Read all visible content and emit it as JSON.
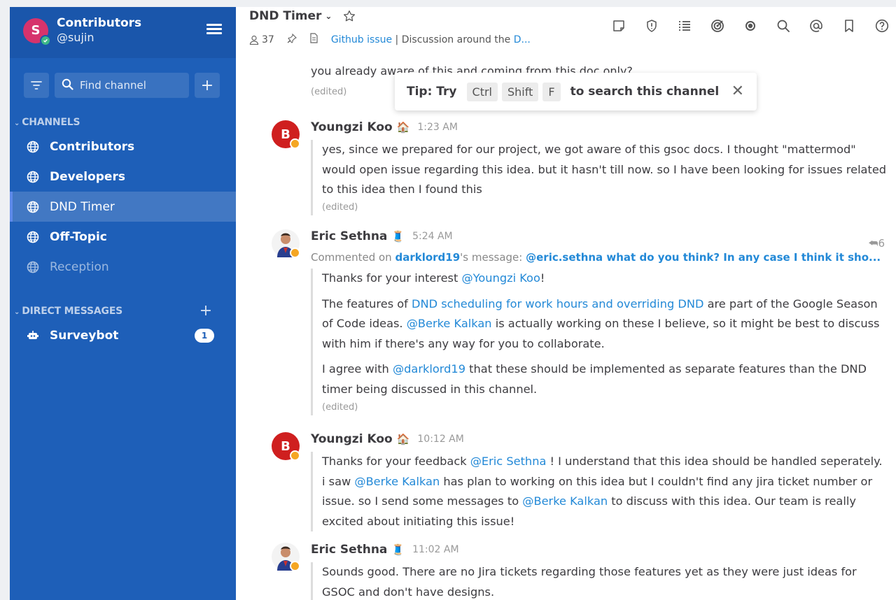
{
  "team": {
    "initial": "S",
    "name": "Contributors",
    "user": "@sujin"
  },
  "sidebar": {
    "find_placeholder": "Find channel",
    "channels_title": "CHANNELS",
    "channels": [
      {
        "label": "Contributors"
      },
      {
        "label": "Developers"
      },
      {
        "label": "DND Timer"
      },
      {
        "label": "Off-Topic"
      },
      {
        "label": "Reception"
      }
    ],
    "dm_title": "DIRECT MESSAGES",
    "dms": [
      {
        "label": "Surveybot",
        "badge": "1"
      }
    ]
  },
  "channel": {
    "title": "DND Timer",
    "members": "37",
    "link": "Github issue",
    "separator": " | ",
    "purpose": "Discussion around the ",
    "purpose_link": "D..."
  },
  "tip": {
    "prefix": "Tip: Try",
    "keys": [
      "Ctrl",
      "Shift",
      "F"
    ],
    "suffix": "to search this channel"
  },
  "top_fragment": "you already aware of this and coming from this doc only?",
  "top_edited": "(edited)",
  "posts": [
    {
      "initial": "B",
      "name": "Youngzi Koo",
      "emoji": "🏠",
      "time": "1:23 AM",
      "body": "yes, since we prepared for our project, we got aware of this gsoc docs. I thought \"mattermod\" would open issue regarding this idea. but it hasn't till now. so I have been looking for issues related to this idea then I found this",
      "edited": "(edited)"
    },
    {
      "name": "Eric Sethna",
      "emoji": "🧵",
      "time": "5:24 AM",
      "reply_count": "6",
      "commented_prefix": "Commented on ",
      "commented_user": "darklord19",
      "commented_mid": "'s message: ",
      "commented_text": "@eric.sethna what do you think? In any case I think it sho...",
      "p1_a": "Thanks for your interest ",
      "p1_m": "@Youngzi Koo",
      "p1_b": "!",
      "p2_a": "The features of ",
      "p2_l": "DND scheduling for work hours and overriding DND",
      "p2_b": " are part of the Google Season of Code ideas. ",
      "p2_m": "@Berke Kalkan",
      "p2_c": " is actually working on these I believe, so it might be best to discuss with him if there's any way for you to collaborate.",
      "p3_a": "I agree with ",
      "p3_m": "@darklord19",
      "p3_b": " that these should be implemented as separate features than the DND timer being discussed in this channel.",
      "edited": "(edited)"
    },
    {
      "initial": "B",
      "name": "Youngzi Koo",
      "emoji": "🏠",
      "time": "10:12 AM",
      "a": "Thanks for your feedback ",
      "m1": "@Eric Sethna",
      "b": " ! I understand that this idea should be handled seperately. i saw ",
      "m2": "@Berke Kalkan",
      "c": " has plan to working on this idea but I couldn't find any jira ticket number or issue. so I send some messages to ",
      "m3": "@Berke Kalkan",
      "d": " to discuss with this idea. Our team is really excited about initiating this issue!"
    },
    {
      "name": "Eric Sethna",
      "emoji": "🧵",
      "time": "11:02 AM",
      "body": "Sounds good. There are no Jira tickets regarding those features yet as they were just ideas for GSOC and don't have designs."
    }
  ],
  "colors": {
    "sidebar": "#1e5fb8",
    "link": "#2389d7",
    "away": "#f5a623"
  }
}
